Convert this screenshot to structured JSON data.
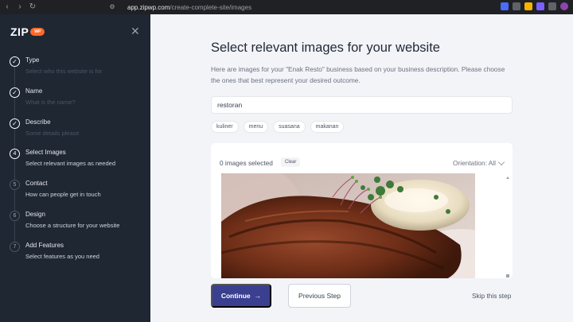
{
  "browser": {
    "url_host": "app.zipwp.com",
    "url_path": "/create-complete-site/images"
  },
  "sidebar": {
    "logo": "ZIP",
    "logo_badge": "WP",
    "steps": [
      {
        "number": "1",
        "title": "Type",
        "subtitle": "Select who this website is for",
        "state": "done"
      },
      {
        "number": "2",
        "title": "Name",
        "subtitle": "What is the name?",
        "state": "done"
      },
      {
        "number": "3",
        "title": "Describe",
        "subtitle": "Some details please",
        "state": "done"
      },
      {
        "number": "4",
        "title": "Select Images",
        "subtitle": "Select relevant images as needed",
        "state": "active"
      },
      {
        "number": "5",
        "title": "Contact",
        "subtitle": "How can people get in touch",
        "state": "pending"
      },
      {
        "number": "6",
        "title": "Design",
        "subtitle": "Choose a structure for your website",
        "state": "pending"
      },
      {
        "number": "7",
        "title": "Add Features",
        "subtitle": "Select features as you need",
        "state": "pending"
      }
    ]
  },
  "main": {
    "title": "Select relevant images for your website",
    "description": "Here are images for your \"Enak Resto\" business based on your business description. Please choose the ones that best represent your desired outcome.",
    "search_value": "restoran",
    "tags": [
      "kuliner",
      "menu",
      "suasana",
      "makanan"
    ],
    "panel": {
      "selected_count": "0 images selected",
      "clear_label": "Clear",
      "orientation_label": "Orientation: All"
    },
    "continue_label": "Continue",
    "previous_label": "Previous Step",
    "skip_label": "Skip this step"
  },
  "colors": {
    "sidebar_bg": "#1f2733",
    "main_bg": "#f3f4f8",
    "primary_button": "#3b3f8f",
    "logo_accent": "#ff6a2a"
  }
}
